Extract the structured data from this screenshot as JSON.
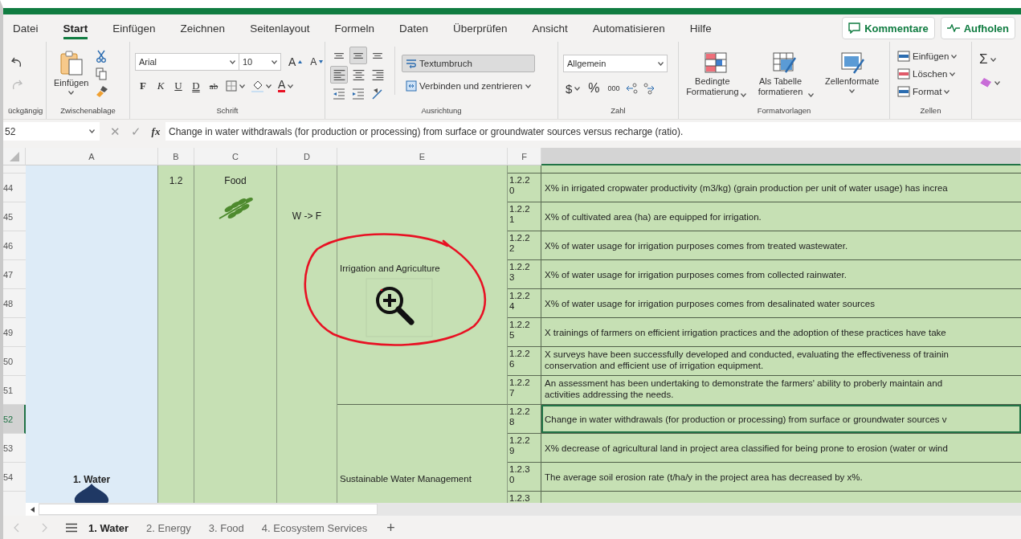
{
  "ribbon_tabs": [
    {
      "label": "Datei",
      "selected": false
    },
    {
      "label": "Start",
      "selected": true
    },
    {
      "label": "Einfügen",
      "selected": false
    },
    {
      "label": "Zeichnen",
      "selected": false
    },
    {
      "label": "Seitenlayout",
      "selected": false
    },
    {
      "label": "Formeln",
      "selected": false
    },
    {
      "label": "Daten",
      "selected": false
    },
    {
      "label": "Überprüfen",
      "selected": false
    },
    {
      "label": "Ansicht",
      "selected": false
    },
    {
      "label": "Automatisieren",
      "selected": false
    },
    {
      "label": "Hilfe",
      "selected": false
    }
  ],
  "header_buttons": [
    {
      "label": "Kommentare",
      "kind": "comments"
    },
    {
      "label": "Aufholen",
      "kind": "catchup"
    }
  ],
  "ribbon": {
    "undo": {
      "label": "ückgängig"
    },
    "clipboard": {
      "paste": "Einfügen",
      "label": "Zwischenablage"
    },
    "font": {
      "name": "Arial",
      "size": "10",
      "grow": "A",
      "shrink": "A",
      "color_letter": "A",
      "label": "Schrift",
      "format_buttons": [
        {
          "label": "F",
          "kind": "bold"
        },
        {
          "label": "K",
          "kind": "italic"
        },
        {
          "label": "U",
          "kind": "underline"
        },
        {
          "label": "D",
          "kind": "double"
        },
        {
          "label": "ab",
          "kind": "strike"
        }
      ]
    },
    "alignment": {
      "label": "Ausrichtung",
      "wrap": {
        "label": "Textumbruch",
        "on": true
      },
      "merge": "Verbinden und zentrieren",
      "align_buttons": [
        {
          "kind": "top",
          "selected": false
        },
        {
          "kind": "middle",
          "selected": true
        },
        {
          "kind": "bottom",
          "selected": false
        },
        {
          "kind": "left",
          "selected": true
        },
        {
          "kind": "center",
          "selected": false
        },
        {
          "kind": "right",
          "selected": false
        }
      ]
    },
    "number": {
      "format": "Allgemein",
      "currency": "$",
      "percent": "%",
      "thousands": "000",
      "label": "Zahl"
    },
    "styles": {
      "label": "Formatvorlagen",
      "buttons": [
        {
          "label": "Bedingte Formatierung",
          "kind": "conditional"
        },
        {
          "label": "Als Tabelle formatieren",
          "kind": "table"
        },
        {
          "label": "Zellenformate",
          "kind": "cellstyles"
        }
      ]
    },
    "cells": {
      "label": "Zellen",
      "buttons": [
        {
          "label": "Einfügen",
          "kind": "insert"
        },
        {
          "label": "Löschen",
          "kind": "delete"
        },
        {
          "label": "Format",
          "kind": "format"
        }
      ]
    },
    "editing": {
      "sum": "Σ"
    }
  },
  "formula_bar": {
    "name_box": "52",
    "cancel": "✕",
    "enter": "✓",
    "fx": "fx",
    "formula": "Change in water withdrawals (for production or processing) from surface or groundwater sources versus recharge (ratio)."
  },
  "sheet": {
    "columns": [
      "A",
      "B",
      "C",
      "D",
      "E",
      "F"
    ],
    "pillar": "1. Water",
    "section": "1.2",
    "topic": "Food",
    "link": "W -> F",
    "groups": [
      "Irrigation and Agriculture",
      "Sustainable Water Management"
    ],
    "rows": [
      {
        "number": "44",
        "id": "1.2.20",
        "text": "X% in irrigated cropwater productivity (m3/kg) (grain production per unit of water usage) has increa",
        "selected": false
      },
      {
        "number": "45",
        "id": "1.2.21",
        "text": "X% of cultivated area (ha) are equipped for irrigation.",
        "selected": false
      },
      {
        "number": "46",
        "id": "1.2.22",
        "text": "X% of water usage for irrigation purposes comes from treated wastewater.",
        "selected": false
      },
      {
        "number": "47",
        "id": "1.2.23",
        "text": "X% of water usage for irrigation purposes comes from collected rainwater.",
        "selected": false
      },
      {
        "number": "48",
        "id": "1.2.24",
        "text": "X% of water usage for irrigation purposes comes from desalinated water sources",
        "selected": false
      },
      {
        "number": "49",
        "id": "1.2.25",
        "text": "X trainings of farmers on efficient irrigation practices and the adoption of these practices have take",
        "selected": false
      },
      {
        "number": "50",
        "id": "1.2.26",
        "text": "X surveys have been successfully developed and conducted, evaluating the effectiveness of trainin\nconservation and efficient use of irrigation equipment.",
        "selected": false
      },
      {
        "number": "51",
        "id": "1.2.27",
        "text": "An assessment has been undertaking to demonstrate the farmers' ability to proberly maintain and\nactivities addressing the needs.",
        "selected": false
      },
      {
        "number": "52",
        "id": "1.2.28",
        "text": "Change in water withdrawals (for production or processing) from surface or groundwater sources v",
        "selected": true
      },
      {
        "number": "53",
        "id": "1.2.29",
        "text": "X% decrease of agricultural land in project area classified for being prone to erosion (water or wind",
        "selected": false
      },
      {
        "number": "54",
        "id": "1.2.30",
        "text": "The average soil erosion rate (t/ha/y in the project area has decreased by x%.",
        "selected": false
      }
    ],
    "partial_row": {
      "id": "1.2.3"
    }
  },
  "sheet_tabs": [
    {
      "label": "1. Water",
      "selected": true
    },
    {
      "label": "2. Energy",
      "selected": false
    },
    {
      "label": "3. Food",
      "selected": false
    },
    {
      "label": "4. Ecosystem Services",
      "selected": false
    }
  ],
  "add_sheet": "+"
}
